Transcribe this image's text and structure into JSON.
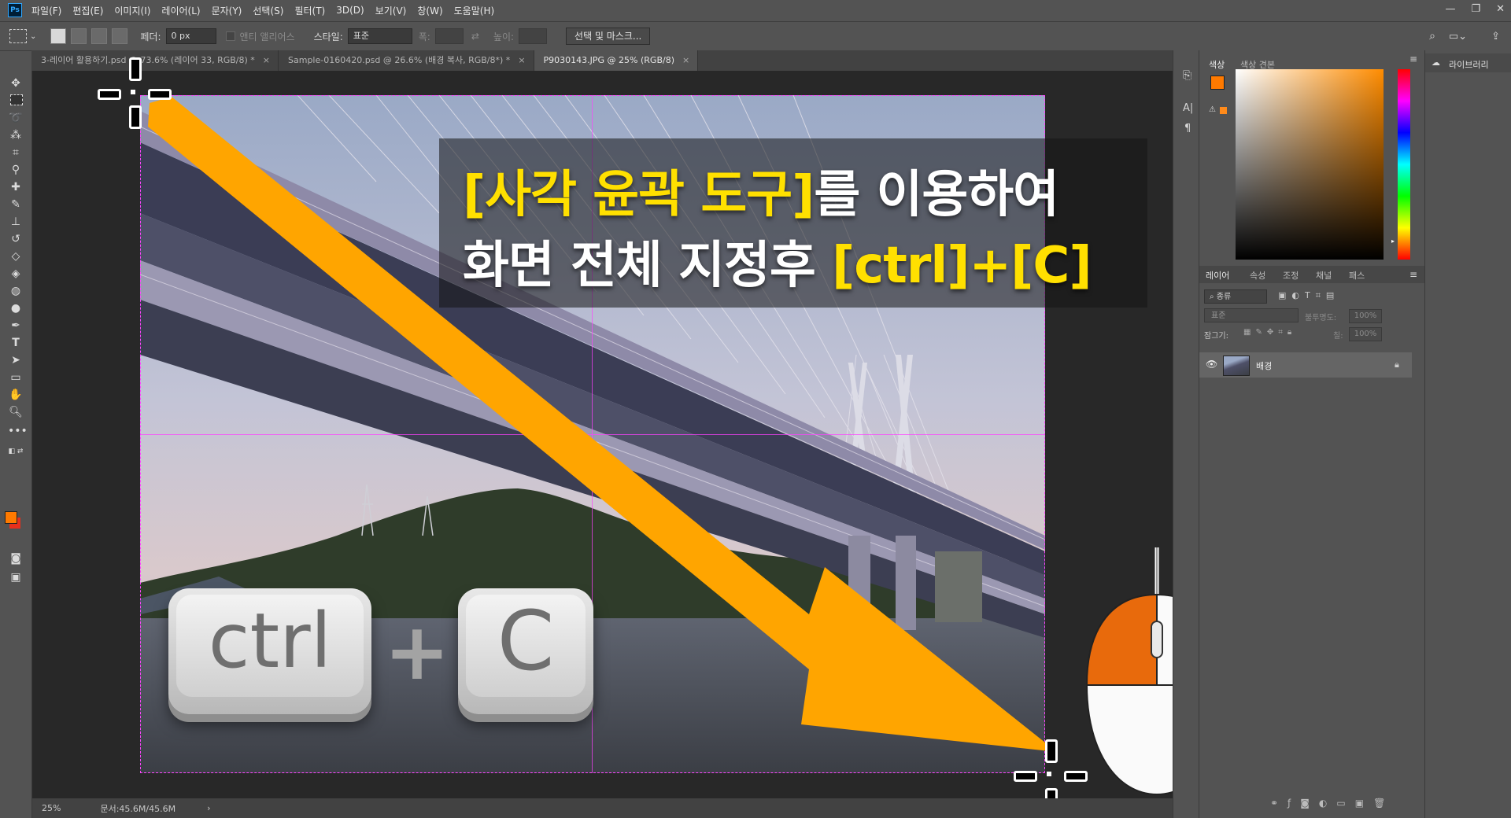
{
  "app": {
    "logo": "Ps"
  },
  "menu": [
    "파일(F)",
    "편집(E)",
    "이미지(I)",
    "레이어(L)",
    "문자(Y)",
    "선택(S)",
    "필터(T)",
    "3D(D)",
    "보기(V)",
    "창(W)",
    "도움말(H)"
  ],
  "window_controls": {
    "minimize": "—",
    "restore": "❐",
    "close": "✕"
  },
  "options": {
    "feather_label": "페더:",
    "feather_value": "0 px",
    "antialias_label": "앤티 앨리어스",
    "style_label": "스타일:",
    "style_value": "표준",
    "width_label": "폭:",
    "height_label": "높이:",
    "select_mask_button": "선택 및 마스크..."
  },
  "tabs": [
    {
      "label": "3-레이어 활용하기.psd @ 73.6% (레이어 33, RGB/8) *",
      "active": false
    },
    {
      "label": "Sample-0160420.psd @ 26.6% (배경 복사, RGB/8*) *",
      "active": false
    },
    {
      "label": "P9030143.JPG @ 25% (RGB/8)",
      "active": true
    }
  ],
  "tab_close": "×",
  "status": {
    "zoom": "25%",
    "doc_info": "문서:45.6M/45.6M",
    "arrow": "›"
  },
  "caption": {
    "line1_highlight": "[사각 윤곽 도구]",
    "line1_rest": "를 이용하여",
    "line2_rest": "화면 전체 지정후 ",
    "line2_highlight": "[ctrl]+[C]"
  },
  "keys": {
    "ctrl": "ctrl",
    "plus": "+",
    "c": "C"
  },
  "panels": {
    "color_tab": "색상",
    "swatches_tab": "색상 견본",
    "libraries": "라이브러리",
    "layers_tabs": [
      "레이어",
      "속성",
      "조정",
      "채널",
      "패스"
    ],
    "filter_kind": "종류",
    "blend_mode": "표준",
    "opacity_label": "불투명도:",
    "opacity_value": "100%",
    "lock_label": "잠그기:",
    "fill_label": "칠:",
    "fill_value": "100%",
    "layer_name": "배경"
  },
  "colors": {
    "foreground": "#ff7a00",
    "background": "#e8301c",
    "arrow": "#ffa500",
    "mouse_button": "#e86a0c",
    "caption_highlight": "#ffe000",
    "selection": "#ff44ff"
  }
}
